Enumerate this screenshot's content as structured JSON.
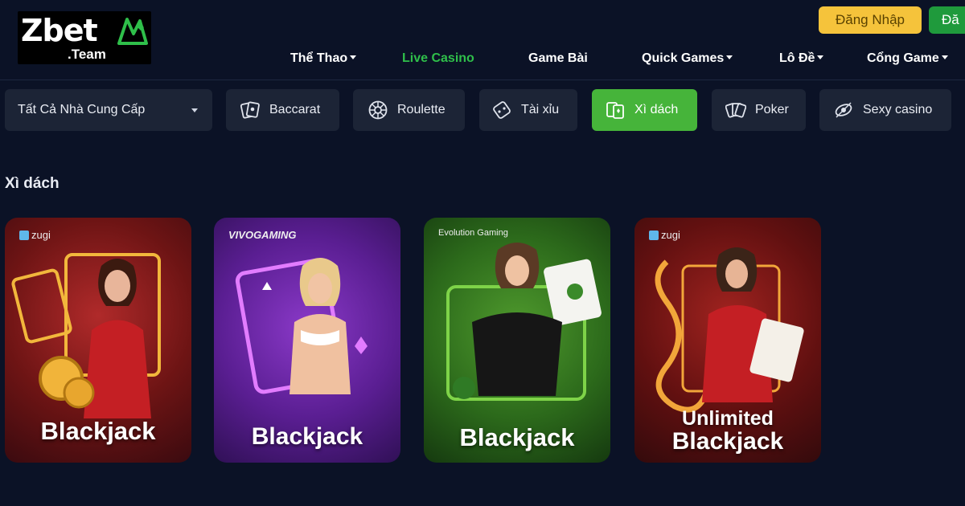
{
  "header": {
    "logo_text": "Zbet",
    "logo_subtext": ".Team",
    "login_label": "Đăng Nhập",
    "register_label": "Đă"
  },
  "nav": {
    "items": [
      {
        "label": "Thể Thao",
        "has_dropdown": true,
        "active": false
      },
      {
        "label": "Live Casino",
        "has_dropdown": false,
        "active": true
      },
      {
        "label": "Game Bài",
        "has_dropdown": false,
        "active": false
      },
      {
        "label": "Quick Games",
        "has_dropdown": true,
        "active": false
      },
      {
        "label": "Lô Đề",
        "has_dropdown": true,
        "active": false
      },
      {
        "label": "Cổng Game",
        "has_dropdown": true,
        "active": false
      }
    ]
  },
  "filters": {
    "provider_select": "Tất Cả Nhà Cung Cấp",
    "categories": [
      {
        "label": "Baccarat",
        "icon": "baccarat-cards-icon",
        "active": false
      },
      {
        "label": "Roulette",
        "icon": "roulette-wheel-icon",
        "active": false
      },
      {
        "label": "Tài xỉu",
        "icon": "dice-icon",
        "active": false
      },
      {
        "label": "Xì dách",
        "icon": "blackjack-cards-icon",
        "active": true
      },
      {
        "label": "Poker",
        "icon": "poker-cards-icon",
        "active": false
      },
      {
        "label": "Sexy casino",
        "icon": "sexy-casino-icon",
        "active": false
      }
    ]
  },
  "section": {
    "title": "Xì dách"
  },
  "games": [
    {
      "provider": "zugi",
      "title_line1": "",
      "title_line2": "Blackjack"
    },
    {
      "provider": "VIVOGAMING",
      "title_line1": "",
      "title_line2": "Blackjack"
    },
    {
      "provider": "Evolution Gaming",
      "title_line1": "",
      "title_line2": "Blackjack"
    },
    {
      "provider": "zugi",
      "title_line1": "Unlimited",
      "title_line2": "Blackjack"
    }
  ],
  "colors": {
    "background": "#0b1226",
    "accent_green": "#2fbf4a",
    "active_filter": "#46b43a",
    "login_yellow": "#f5c33b",
    "register_green": "#1f9a3c"
  }
}
